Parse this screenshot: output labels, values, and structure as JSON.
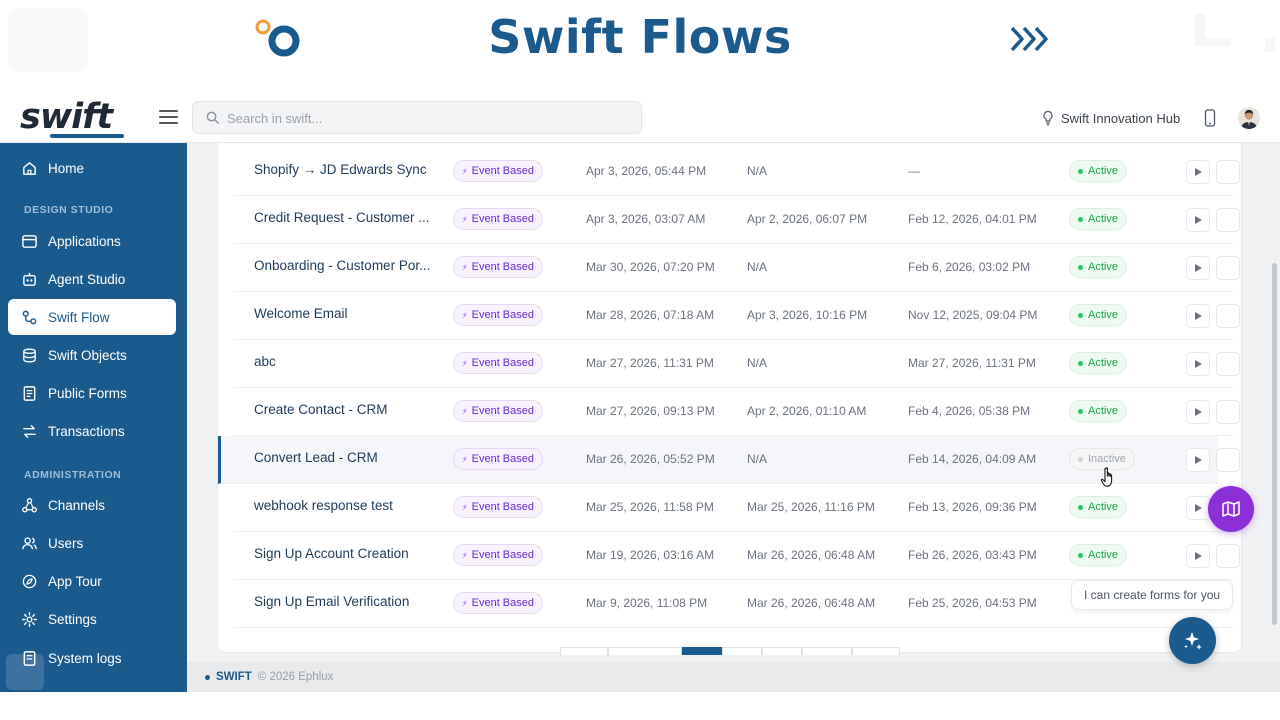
{
  "banner": {
    "title": "Swift Flows"
  },
  "topbar": {
    "logo": "swift",
    "search_placeholder": "Search in swift...",
    "hub_label": "Swift Innovation Hub"
  },
  "sidebar": {
    "home": "Home",
    "design_studio_header": "DESIGN STUDIO",
    "applications": "Applications",
    "agent_studio": "Agent Studio",
    "swift_flow": "Swift Flow",
    "swift_objects": "Swift Objects",
    "public_forms": "Public Forms",
    "transactions": "Transactions",
    "administration_header": "ADMINISTRATION",
    "channels": "Channels",
    "users": "Users",
    "app_tour": "App Tour",
    "settings": "Settings",
    "system_logs": "System logs"
  },
  "flows": [
    {
      "name": "Shopify → JD Edwards Sync",
      "trigger": "Event Based",
      "created": "Apr 3, 2026, 05:44 PM",
      "updated": "N/A",
      "last_run": "—",
      "status": "Active"
    },
    {
      "name": "Credit Request - Customer ...",
      "trigger": "Event Based",
      "created": "Apr 3, 2026, 03:07 AM",
      "updated": "Apr 2, 2026, 06:07 PM",
      "last_run": "Feb 12, 2026, 04:01 PM",
      "status": "Active"
    },
    {
      "name": "Onboarding - Customer Por...",
      "trigger": "Event Based",
      "created": "Mar 30, 2026, 07:20 PM",
      "updated": "N/A",
      "last_run": "Feb 6, 2026, 03:02 PM",
      "status": "Active"
    },
    {
      "name": "Welcome Email",
      "trigger": "Event Based",
      "created": "Mar 28, 2026, 07:18 AM",
      "updated": "Apr 3, 2026, 10:16 PM",
      "last_run": "Nov 12, 2025, 09:04 PM",
      "status": "Active"
    },
    {
      "name": "abc",
      "trigger": "Event Based",
      "created": "Mar 27, 2026, 11:31 PM",
      "updated": "N/A",
      "last_run": "Mar 27, 2026, 11:31 PM",
      "status": "Active"
    },
    {
      "name": "Create Contact - CRM",
      "trigger": "Event Based",
      "created": "Mar 27, 2026, 09:13 PM",
      "updated": "Apr 2, 2026, 01:10 AM",
      "last_run": "Feb 4, 2026, 05:38 PM",
      "status": "Active"
    },
    {
      "name": "Convert Lead - CRM",
      "trigger": "Event Based",
      "created": "Mar 26, 2026, 05:52 PM",
      "updated": "N/A",
      "last_run": "Feb 14, 2026, 04:09 AM",
      "status": "Inactive"
    },
    {
      "name": "webhook response test",
      "trigger": "Event Based",
      "created": "Mar 25, 2026, 11:58 PM",
      "updated": "Mar 25, 2026, 11:16 PM",
      "last_run": "Feb 13, 2026, 09:36 PM",
      "status": "Active"
    },
    {
      "name": "Sign Up Account Creation",
      "trigger": "Event Based",
      "created": "Mar 19, 2026, 03:16 AM",
      "updated": "Mar 26, 2026, 06:48 AM",
      "last_run": "Feb 26, 2026, 03:43 PM",
      "status": "Active"
    },
    {
      "name": "Sign Up Email Verification",
      "trigger": "Event Based",
      "created": "Mar 9, 2026, 11:08 PM",
      "updated": "Mar 26, 2026, 06:48 AM",
      "last_run": "Feb 25, 2026, 04:53 PM",
      "status": ""
    }
  ],
  "footer": {
    "brand": "SWIFT",
    "copyright": "© 2026 Ephlux"
  },
  "assistant": {
    "tooltip": "I can create forms for you"
  },
  "colors": {
    "brand": "#1b5a8c",
    "active": "#16a34a",
    "badge": "#6d28d9",
    "map_fab": "#8b2fd9"
  }
}
